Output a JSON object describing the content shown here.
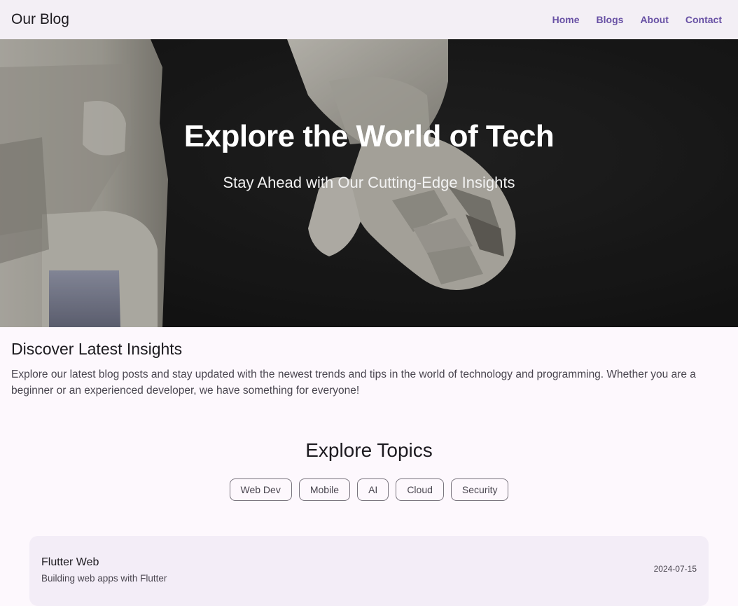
{
  "app_bar": {
    "title": "Our Blog",
    "nav": [
      "Home",
      "Blogs",
      "About",
      "Contact"
    ]
  },
  "hero": {
    "title": "Explore the World of Tech",
    "subtitle": "Stay Ahead with Our Cutting-Edge Insights"
  },
  "insights": {
    "heading": "Discover Latest Insights",
    "text": "Explore our latest blog posts and stay updated with the newest trends and tips in the world of technology and programming. Whether you are a beginner or an experienced developer, we have something for everyone!"
  },
  "topics": {
    "heading": "Explore Topics",
    "chips": [
      "Web Dev",
      "Mobile",
      "AI",
      "Cloud",
      "Security"
    ]
  },
  "posts": [
    {
      "title": "Flutter Web",
      "subtitle": "Building web apps with Flutter",
      "date": "2024-07-15"
    }
  ],
  "colors": {
    "accent": "#6750a4",
    "background": "#fdf8fd",
    "app_bar": "#f3eff5",
    "card": "#f3edf7"
  }
}
